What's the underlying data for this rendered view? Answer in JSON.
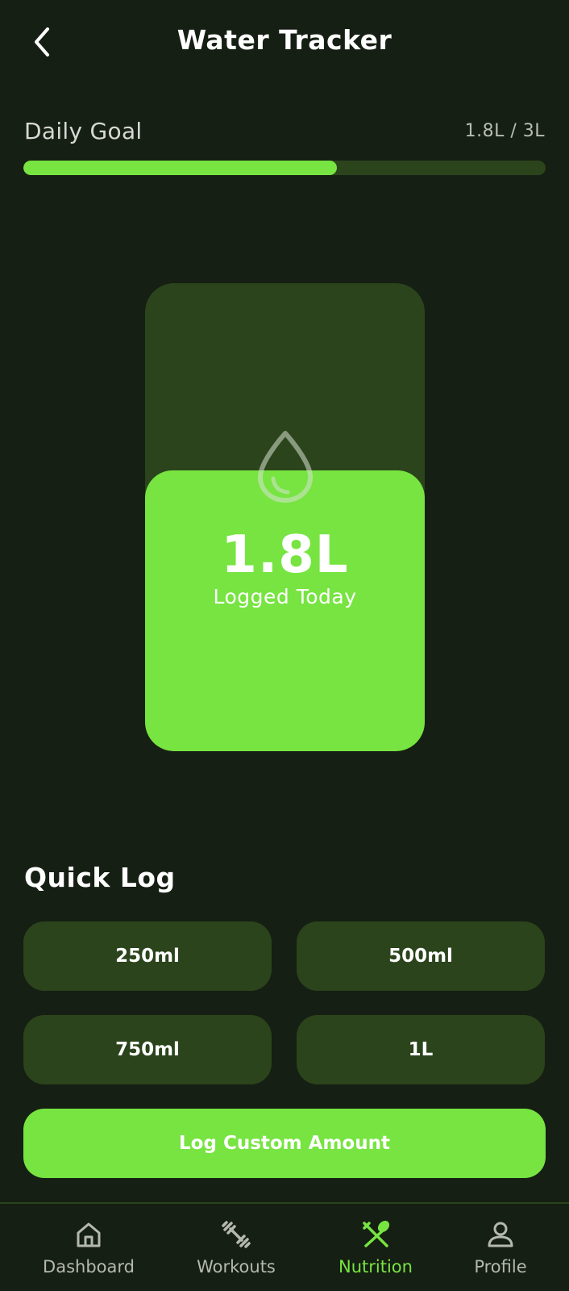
{
  "header": {
    "title": "Water Tracker",
    "back_icon": "chevron-left-icon"
  },
  "daily_goal": {
    "label": "Daily Goal",
    "value_text": "1.8L / 3L",
    "progress_fraction": 0.6,
    "track_color": "#2b441c",
    "fill_color": "#77e441"
  },
  "bottle": {
    "amount": "1.8L",
    "subtitle": "Logged Today",
    "fill_fraction": 0.6,
    "icon": "water-drop-icon"
  },
  "quick_log": {
    "title": "Quick Log",
    "options": [
      {
        "label": "250ml"
      },
      {
        "label": "500ml"
      },
      {
        "label": "750ml"
      },
      {
        "label": "1L"
      }
    ],
    "custom_label": "Log Custom Amount"
  },
  "nav": {
    "items": [
      {
        "label": "Dashboard",
        "icon": "home-icon",
        "active": false
      },
      {
        "label": "Workouts",
        "icon": "dumbbell-icon",
        "active": false
      },
      {
        "label": "Nutrition",
        "icon": "utensils-icon",
        "active": true
      },
      {
        "label": "Profile",
        "icon": "user-icon",
        "active": false
      }
    ]
  },
  "colors": {
    "background": "#161f13",
    "accent": "#77e441",
    "surface": "#2b441c",
    "muted_text": "#b4b8b1"
  }
}
